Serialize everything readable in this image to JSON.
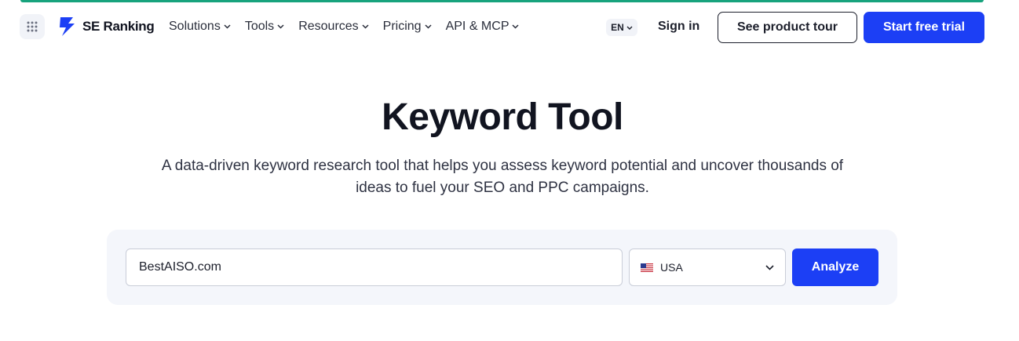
{
  "header": {
    "logo_text": "SE Ranking",
    "nav": [
      {
        "label": "Solutions"
      },
      {
        "label": "Tools"
      },
      {
        "label": "Resources"
      },
      {
        "label": "Pricing"
      },
      {
        "label": "API & MCP"
      }
    ],
    "lang": "EN",
    "signin": "Sign in",
    "tour_label": "See product tour",
    "trial_label": "Start free trial"
  },
  "hero": {
    "title": "Keyword Tool",
    "subtitle_line1": "A data-driven keyword research tool that helps you assess keyword potential and uncover thousands of",
    "subtitle_line2": "ideas to fuel your SEO and PPC campaigns."
  },
  "search": {
    "input_value": "BestAISO.com",
    "country": "USA",
    "analyze_label": "Analyze"
  },
  "colors": {
    "accent_bar": "#17a37d",
    "primary": "#1c3ff5",
    "panel_bg": "#f4f6fb"
  },
  "icons": {
    "apps": "apps-grid-icon",
    "logo": "se-ranking-logo-icon",
    "chevron": "chevron-down-icon",
    "flag": "usa-flag-icon"
  }
}
